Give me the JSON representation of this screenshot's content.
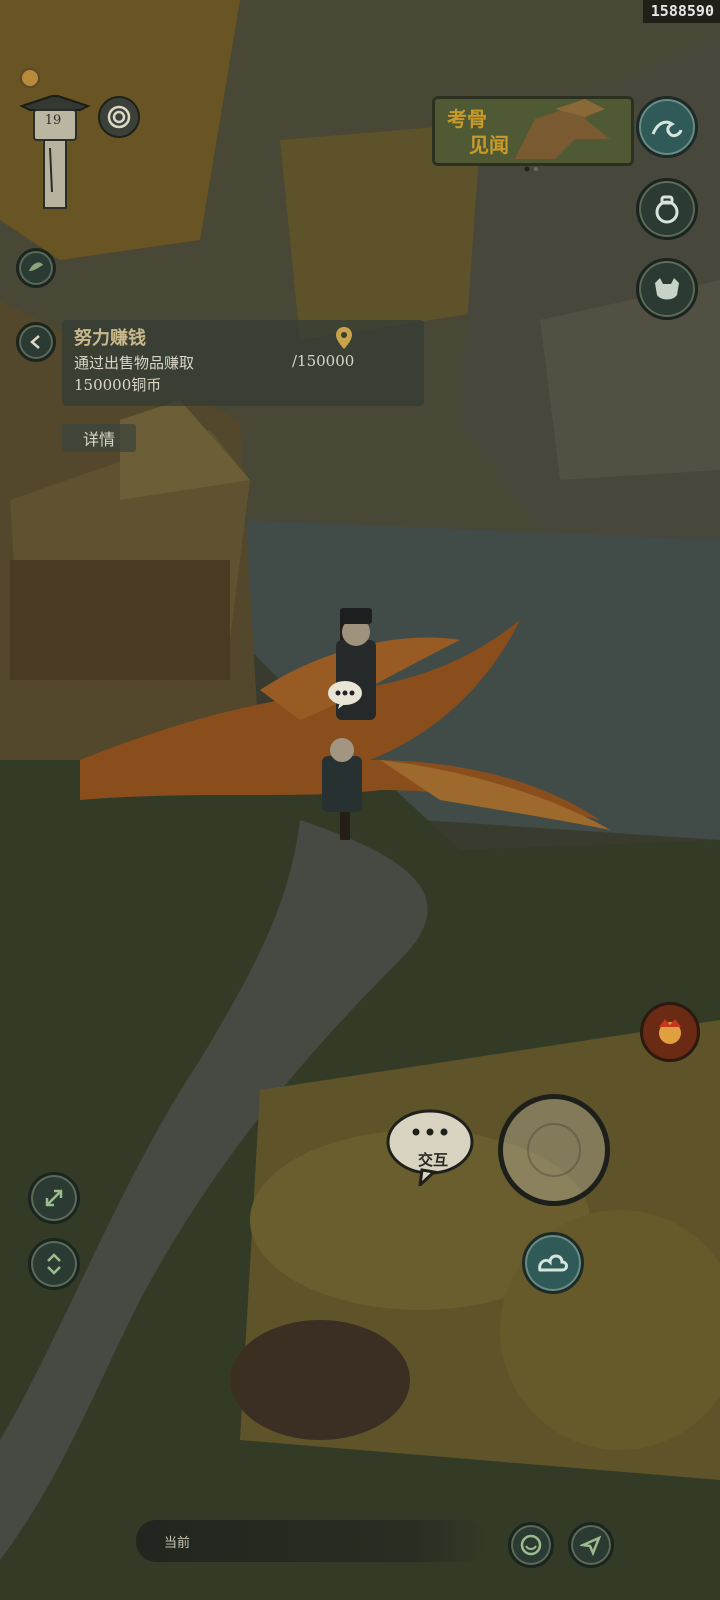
{
  "hud": {
    "player_id": "1588590",
    "level": "19"
  },
  "quest": {
    "title": "努力赚钱",
    "description": "通过出售物品赚取",
    "progress_current": "",
    "progress_target": "/150000",
    "reward": "150000铜币",
    "details_label": "详情"
  },
  "event_banner": {
    "line1": "考骨",
    "line2": "见闻"
  },
  "interact": {
    "label": "交互"
  },
  "chat": {
    "channel_label": "当前"
  },
  "icons": {
    "level_totem": "stone-totem-icon",
    "spiral": "spiral-icon",
    "sidebar_small": "leaf-icon",
    "back": "chevron-left-icon",
    "quest_pin": "location-pin-icon",
    "wave": "wave-icon",
    "bag": "bag-icon",
    "pet": "pet-icon",
    "hero": "hero-portrait-icon",
    "expand": "expand-icon",
    "swap": "swap-icon",
    "skill": "cloud-swirl-icon",
    "attack": "attack-ring-icon",
    "emoji": "emoji-icon",
    "send": "send-icon"
  },
  "colors": {
    "progress_current": "#8c2b2b",
    "quest_title": "#c9b98a",
    "event_title": "#c99a2a"
  }
}
